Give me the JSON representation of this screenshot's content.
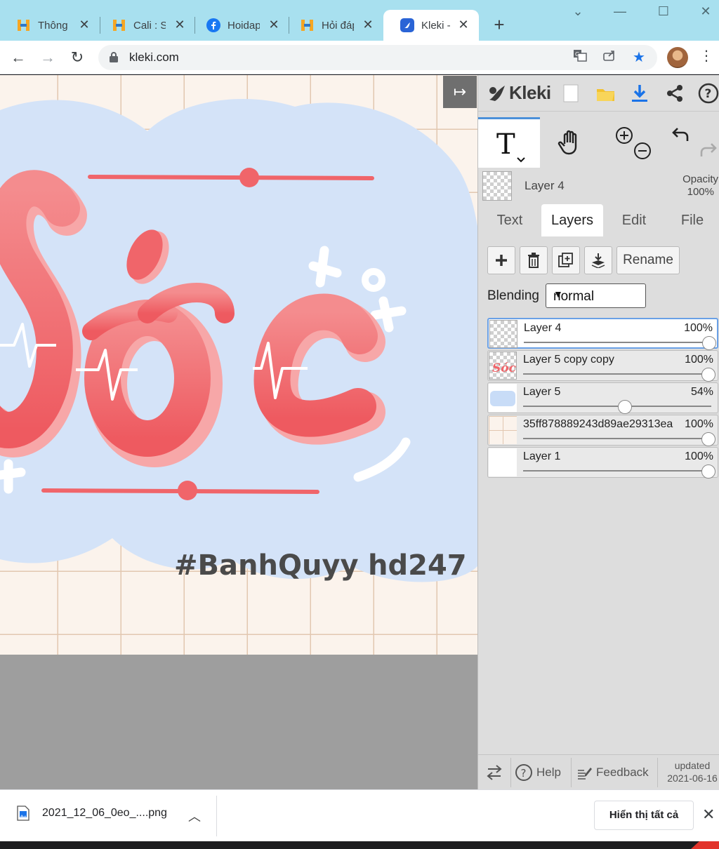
{
  "browser": {
    "tabs": [
      {
        "title": "Thông",
        "icon": "hoidap-icon"
      },
      {
        "title": "Cali : S",
        "icon": "hoidap-icon"
      },
      {
        "title": "Hoidap",
        "icon": "facebook-icon"
      },
      {
        "title": "Hỏi đáp",
        "icon": "hoidap-icon"
      },
      {
        "title": "Kleki -",
        "icon": "kleki-icon",
        "active": true
      }
    ],
    "url": "kleki.com"
  },
  "artwork": {
    "main_text": "Sóc",
    "hashtag": "#BanhQuyy",
    "tag": "hd247",
    "colors": {
      "cloud": "#d4e3f8",
      "grid_bg": "#fbf3ec",
      "grid_line": "#e2c7b0",
      "text_red": "#f0656a",
      "light_pink": "#f7a7a8"
    }
  },
  "kleki": {
    "logo": "Kleki",
    "current_layer": {
      "name": "Layer 4",
      "opacity_label": "Opacity",
      "opacity": "100%"
    },
    "tabs": [
      "Text",
      "Layers",
      "Edit",
      "File"
    ],
    "active_tab": "Layers",
    "buttons": {
      "rename": "Rename"
    },
    "blending": {
      "label": "Blending",
      "value": "normal"
    },
    "layers": [
      {
        "name": "Layer 4",
        "opacity": "100%",
        "value": 1.0,
        "selected": true
      },
      {
        "name": "Layer 5 copy copy",
        "opacity": "100%",
        "value": 1.0
      },
      {
        "name": "Layer 5",
        "opacity": "54%",
        "value": 0.54
      },
      {
        "name": "35ff878889243d89ae29313ea",
        "opacity": "100%",
        "value": 1.0
      },
      {
        "name": "Layer 1",
        "opacity": "100%",
        "value": 1.0
      }
    ],
    "footer": {
      "help": "Help",
      "feedback": "Feedback",
      "updated_label": "updated",
      "updated_date": "2021-06-16"
    }
  },
  "downloads": {
    "file": "2021_12_06_0eo_....png",
    "show_all": "Hiển thị tất cả"
  }
}
